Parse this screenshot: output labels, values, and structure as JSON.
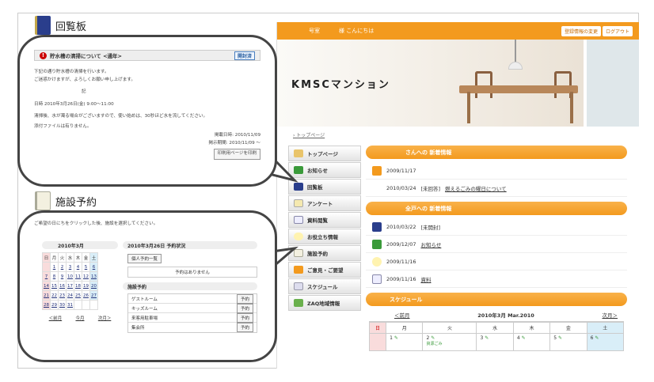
{
  "site": {
    "greeting_room": "号室",
    "greeting_name": "様 こんにちは",
    "actions": [
      "登録情報の変更",
      "ログアウト"
    ],
    "name": "KMSCマンション",
    "breadcrumb": "› トップページ",
    "nav": [
      "トップページ",
      "お知らせ",
      "回覧板",
      "アンケート",
      "資料閲覧",
      "お役立ち情報",
      "施設予約",
      "ご意見・ご要望",
      "スケジュール",
      "ZAQ地域情報"
    ],
    "new_info_title": "さんへの 新着情報",
    "new_info": [
      {
        "date": "2009/11/17",
        "text": "",
        "link": ""
      }
    ],
    "new_info_note": {
      "date": "2010/03/24",
      "tag": "[未回答]",
      "link": "燃えるごみの曜日について"
    },
    "all_info_title": "全戸への 新着情報",
    "all_info": [
      {
        "date": "2010/03/22",
        "tag": "[未開封]",
        "link": ""
      },
      {
        "date": "2009/12/07",
        "tag": "",
        "link": "お知らせ"
      },
      {
        "date": "2009/11/16",
        "tag": "",
        "link": ""
      },
      {
        "date": "2009/11/16",
        "tag": "",
        "link": "資料"
      }
    ],
    "schedule_title": "スケジュール",
    "calendar": {
      "prev": "＜前月",
      "month": "2010年3月 Mar.2010",
      "next": "次月＞",
      "weekdays": [
        "日",
        "月",
        "火",
        "水",
        "木",
        "金",
        "土"
      ],
      "first_row": [
        "",
        "1",
        "2",
        "3",
        "4",
        "5",
        "6"
      ],
      "event_label": "資源ごみ"
    }
  },
  "kairan": {
    "title": "回覧板",
    "notice_title": "貯水槽の清掃について <通年>",
    "notice_tag": "開封済",
    "lines": [
      "下記の通り貯水槽の清掃を行います。",
      "ご迷惑かけますが、よろしくお願い申し上げます。",
      "記",
      "日時  2010年3月26日(金)  9:00～11:00",
      "清掃後、水が濁る場合がございますので、使い始めは、30秒ほど水を流してください。",
      "添付ファイルは有りません。"
    ],
    "posted": "掲載日時: 2010/11/09",
    "period": "掲示期間: 2010/11/09 ～",
    "print_button": "印刷用ページを印刷"
  },
  "facility": {
    "title": "施設予約",
    "instruction": "ご希望の日にちをクリックした後、施設を選択してください。",
    "month": "2010年3月",
    "weekdays": [
      "日",
      "月",
      "火",
      "水",
      "木",
      "金",
      "土"
    ],
    "rows": [
      [
        "",
        "1",
        "2",
        "3",
        "4",
        "5",
        "6"
      ],
      [
        "7",
        "8",
        "9",
        "10",
        "11",
        "12",
        "13"
      ],
      [
        "14",
        "15",
        "16",
        "17",
        "18",
        "19",
        "20"
      ],
      [
        "21",
        "22",
        "23",
        "24",
        "25",
        "26",
        "27"
      ],
      [
        "28",
        "29",
        "30",
        "31",
        "",
        "",
        ""
      ]
    ],
    "prev": "＜前月",
    "current": "今月",
    "next": "次月＞",
    "status_title": "2010年3月26日 予約状況",
    "personal_button": "個人予約一覧",
    "no_reservation": "予約はありません",
    "list_title": "施設予約",
    "facilities": [
      "ゲストルーム",
      "キッズルーム",
      "来客用駐車場",
      "集会所"
    ],
    "reserve_label": "予約"
  }
}
